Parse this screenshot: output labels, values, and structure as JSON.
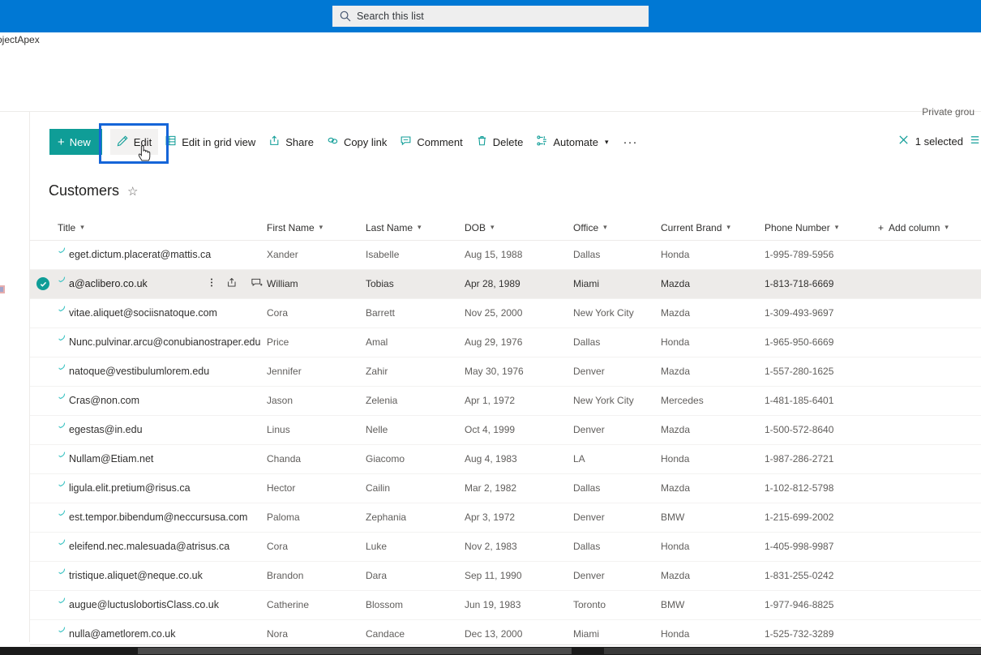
{
  "suite": {
    "search": {
      "placeholder": "Search this list",
      "icon": "search-icon"
    },
    "brand_color": "#0078D4"
  },
  "site": {
    "name": "ojectApex",
    "privacy": "Private grou"
  },
  "command_bar": {
    "new_label": "New",
    "items": [
      {
        "label": "Edit",
        "icon": "pencil-icon",
        "active": true
      },
      {
        "label": "Edit in grid view",
        "icon": "grid-icon",
        "active": false
      },
      {
        "label": "Share",
        "icon": "share-icon",
        "active": false
      },
      {
        "label": "Copy link",
        "icon": "link-icon",
        "active": false
      },
      {
        "label": "Comment",
        "icon": "comment-icon",
        "active": false
      },
      {
        "label": "Delete",
        "icon": "trash-icon",
        "active": false
      },
      {
        "label": "Automate",
        "icon": "automate-icon",
        "active": false,
        "chevron": true
      }
    ],
    "overflow_label": "···",
    "selected_label": "1 selected",
    "clear_icon": "close-icon",
    "view_icon": "list-view-icon"
  },
  "list": {
    "title": "Customers",
    "favorite_icon": "star-icon",
    "columns": [
      {
        "key": "title",
        "label": "Title"
      },
      {
        "key": "first",
        "label": "First Name"
      },
      {
        "key": "last",
        "label": "Last Name"
      },
      {
        "key": "dob",
        "label": "DOB"
      },
      {
        "key": "office",
        "label": "Office"
      },
      {
        "key": "brand",
        "label": "Current Brand"
      },
      {
        "key": "phone",
        "label": "Phone Number"
      },
      {
        "key": "add",
        "label": "Add column"
      }
    ],
    "rows": [
      {
        "title": "eget.dictum.placerat@mattis.ca",
        "first": "Xander",
        "last": "Isabelle",
        "dob": "Aug 15, 1988",
        "office": "Dallas",
        "brand": "Honda",
        "phone": "1-995-789-5956",
        "selected": false
      },
      {
        "title": "a@aclibero.co.uk",
        "first": "William",
        "last": "Tobias",
        "dob": "Apr 28, 1989",
        "office": "Miami",
        "brand": "Mazda",
        "phone": "1-813-718-6669",
        "selected": true
      },
      {
        "title": "vitae.aliquet@sociisnatoque.com",
        "first": "Cora",
        "last": "Barrett",
        "dob": "Nov 25, 2000",
        "office": "New York City",
        "brand": "Mazda",
        "phone": "1-309-493-9697",
        "selected": false
      },
      {
        "title": "Nunc.pulvinar.arcu@conubianostraper.edu",
        "first": "Price",
        "last": "Amal",
        "dob": "Aug 29, 1976",
        "office": "Dallas",
        "brand": "Honda",
        "phone": "1-965-950-6669",
        "selected": false
      },
      {
        "title": "natoque@vestibulumlorem.edu",
        "first": "Jennifer",
        "last": "Zahir",
        "dob": "May 30, 1976",
        "office": "Denver",
        "brand": "Mazda",
        "phone": "1-557-280-1625",
        "selected": false
      },
      {
        "title": "Cras@non.com",
        "first": "Jason",
        "last": "Zelenia",
        "dob": "Apr 1, 1972",
        "office": "New York City",
        "brand": "Mercedes",
        "phone": "1-481-185-6401",
        "selected": false
      },
      {
        "title": "egestas@in.edu",
        "first": "Linus",
        "last": "Nelle",
        "dob": "Oct 4, 1999",
        "office": "Denver",
        "brand": "Mazda",
        "phone": "1-500-572-8640",
        "selected": false
      },
      {
        "title": "Nullam@Etiam.net",
        "first": "Chanda",
        "last": "Giacomo",
        "dob": "Aug 4, 1983",
        "office": "LA",
        "brand": "Honda",
        "phone": "1-987-286-2721",
        "selected": false
      },
      {
        "title": "ligula.elit.pretium@risus.ca",
        "first": "Hector",
        "last": "Cailin",
        "dob": "Mar 2, 1982",
        "office": "Dallas",
        "brand": "Mazda",
        "phone": "1-102-812-5798",
        "selected": false
      },
      {
        "title": "est.tempor.bibendum@neccursusa.com",
        "first": "Paloma",
        "last": "Zephania",
        "dob": "Apr 3, 1972",
        "office": "Denver",
        "brand": "BMW",
        "phone": "1-215-699-2002",
        "selected": false
      },
      {
        "title": "eleifend.nec.malesuada@atrisus.ca",
        "first": "Cora",
        "last": "Luke",
        "dob": "Nov 2, 1983",
        "office": "Dallas",
        "brand": "Honda",
        "phone": "1-405-998-9987",
        "selected": false
      },
      {
        "title": "tristique.aliquet@neque.co.uk",
        "first": "Brandon",
        "last": "Dara",
        "dob": "Sep 11, 1990",
        "office": "Denver",
        "brand": "Mazda",
        "phone": "1-831-255-0242",
        "selected": false
      },
      {
        "title": "augue@luctuslobortisClass.co.uk",
        "first": "Catherine",
        "last": "Blossom",
        "dob": "Jun 19, 1983",
        "office": "Toronto",
        "brand": "BMW",
        "phone": "1-977-946-8825",
        "selected": false
      },
      {
        "title": "nulla@ametlorem.co.uk",
        "first": "Nora",
        "last": "Candace",
        "dob": "Dec 13, 2000",
        "office": "Miami",
        "brand": "Honda",
        "phone": "1-525-732-3289",
        "selected": false
      }
    ]
  },
  "colors": {
    "accent_blue": "#0078D4",
    "teal": "#0F9D97",
    "focus_outline": "#1565d8",
    "selected_row": "#edebe9"
  }
}
